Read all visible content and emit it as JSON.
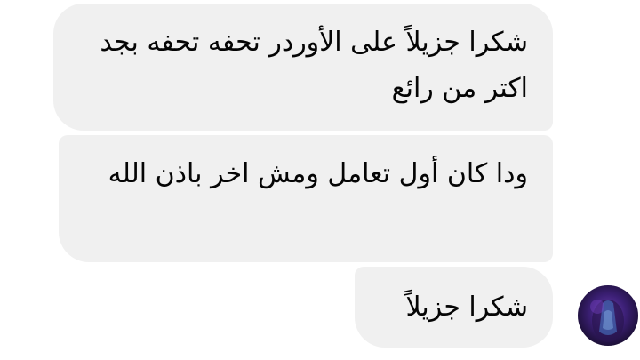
{
  "conversation": {
    "messages": [
      {
        "sender": "contact",
        "text": "شكرا جزيلاً على الأوردر تحفه تحفه بجد اكتر من رائع"
      },
      {
        "sender": "contact",
        "text": "ودا كان أول تعامل ومش اخر باذن الله"
      },
      {
        "sender": "contact",
        "text": "شكرا جزيلاً"
      }
    ],
    "avatar_icon": "profile-avatar",
    "bubble_color": "#f0f0f0",
    "text_color": "#050505"
  }
}
